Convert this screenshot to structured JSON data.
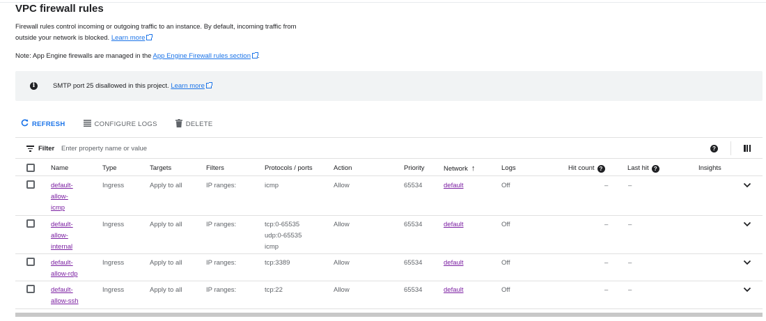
{
  "page": {
    "title": "VPC firewall rules",
    "description": "Firewall rules control incoming or outgoing traffic to an instance. By default, incoming traffic from outside your network is blocked.",
    "description_link": "Learn more",
    "note_prefix": "Note: App Engine firewalls are managed in the",
    "note_link": "App Engine Firewall rules section",
    "note_suffix": "."
  },
  "banner": {
    "icon": "info-icon",
    "text": "SMTP port 25 disallowed in this project.",
    "link": "Learn more"
  },
  "toolbar": {
    "refresh_label": "REFRESH",
    "configure_logs_label": "CONFIGURE LOGS",
    "delete_label": "DELETE"
  },
  "filter": {
    "label": "Filter",
    "placeholder": "Enter property name or value"
  },
  "table": {
    "headers": {
      "name": "Name",
      "type": "Type",
      "targets": "Targets",
      "filters": "Filters",
      "protocols": "Protocols / ports",
      "action": "Action",
      "priority": "Priority",
      "network": "Network",
      "logs": "Logs",
      "hit_count": "Hit count",
      "last_hit": "Last hit",
      "insights": "Insights"
    },
    "rows": [
      {
        "name": "default-allow-icmp",
        "name_lines": [
          "default-",
          "allow-",
          "icmp"
        ],
        "type": "Ingress",
        "targets": "Apply to all",
        "filters": "IP ranges:",
        "protocols": [
          "icmp"
        ],
        "action": "Allow",
        "priority": "65534",
        "network": "default",
        "logs": "Off",
        "hit_count": "–",
        "last_hit": "–"
      },
      {
        "name": "default-allow-internal",
        "name_lines": [
          "default-",
          "allow-",
          "internal"
        ],
        "type": "Ingress",
        "targets": "Apply to all",
        "filters": "IP ranges:",
        "protocols": [
          "tcp:0-65535",
          "udp:0-65535",
          "icmp"
        ],
        "action": "Allow",
        "priority": "65534",
        "network": "default",
        "logs": "Off",
        "hit_count": "–",
        "last_hit": "–"
      },
      {
        "name": "default-allow-rdp",
        "name_lines": [
          "default-",
          "allow-rdp"
        ],
        "type": "Ingress",
        "targets": "Apply to all",
        "filters": "IP ranges:",
        "protocols": [
          "tcp:3389"
        ],
        "action": "Allow",
        "priority": "65534",
        "network": "default",
        "logs": "Off",
        "hit_count": "–",
        "last_hit": "–"
      },
      {
        "name": "default-allow-ssh",
        "name_lines": [
          "default-",
          "allow-ssh"
        ],
        "type": "Ingress",
        "targets": "Apply to all",
        "filters": "IP ranges:",
        "protocols": [
          "tcp:22"
        ],
        "action": "Allow",
        "priority": "65534",
        "network": "default",
        "logs": "Off",
        "hit_count": "–",
        "last_hit": "–"
      }
    ]
  },
  "colors": {
    "link": "#1a73e8",
    "visited_link": "#7b1fa2",
    "banner_bg": "#f1f3f4"
  }
}
